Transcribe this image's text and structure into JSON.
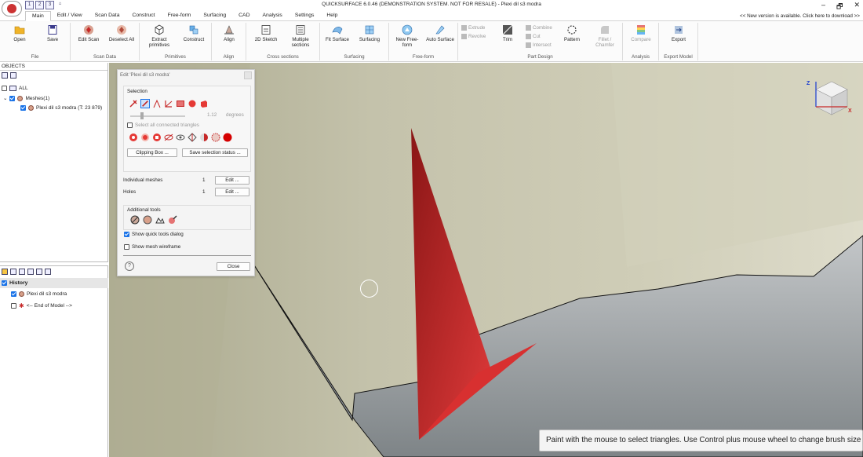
{
  "window": {
    "title": "QUICKSURFACE 6.0.46 (DEMONSTRATION SYSTEM. NOT FOR RESALE) - Plexi dil s3 modra",
    "update_notice": "<< New version is available. Click here to download >>",
    "qat": [
      "1",
      "2",
      "3"
    ],
    "controls": [
      "–",
      "🗗",
      "✕"
    ]
  },
  "tabs": [
    "Main",
    "Edit / View",
    "Scan Data",
    "Construct",
    "Free-form",
    "Surfacing",
    "CAD",
    "Analysis",
    "Settings",
    "Help"
  ],
  "ribbon": {
    "file": {
      "label": "File",
      "open": "Open",
      "save": "Save"
    },
    "scan_data": {
      "label": "Scan Data",
      "edit_scan": "Edit Scan",
      "deselect_all": "Deselect All"
    },
    "primitives": {
      "label": "Primitives",
      "extract": "Extract primitives",
      "construct": "Construct"
    },
    "align": {
      "label": "Align",
      "align": "Align"
    },
    "cross_sections": {
      "label": "Cross sections",
      "sketch2d": "2D Sketch",
      "multiple": "Multiple sections"
    },
    "surfacing": {
      "label": "Surfacing",
      "fit": "Fit Surface",
      "surfacing": "Surfacing"
    },
    "free_form": {
      "label": "Free-form",
      "new": "New Free-form",
      "auto": "Auto Surface"
    },
    "part_design": {
      "label": "Part Design",
      "extrude": "Extrude",
      "revolve": "Revolve",
      "trim": "Trim",
      "combine": "Combine",
      "cut": "Cut",
      "intersect": "Intersect",
      "pattern": "Pattern",
      "fillet": "Fillet / Chamfer"
    },
    "analysis": {
      "label": "Analysis",
      "compare": "Compare"
    },
    "export_model": {
      "label": "Export Model",
      "export": "Export"
    }
  },
  "objects_panel": {
    "header": "OBJECTS",
    "all": "ALL",
    "meshes": "Meshes(1)",
    "mesh_item": "Plexi dil s3 modra (T: 23 879)"
  },
  "history_panel": {
    "header": "History",
    "items": [
      "Plexi dil s3 modra",
      "<-- End of Model -->"
    ]
  },
  "dialog": {
    "title": "Edit 'Plexi dil s3 modra'",
    "selection_label": "Selection",
    "angle_value": "1.12",
    "angle_unit": "degrees",
    "select_connected": "Select all connected triangles",
    "clipping_box": "Clipping Box ...",
    "save_selection": "Save selection status ...",
    "individual_meshes_label": "Individual meshes",
    "individual_meshes_count": "1",
    "holes_label": "Holes",
    "holes_count": "1",
    "edit_button": "Edit ...",
    "additional_tools": "Additional tools",
    "show_quick_tools": "Show quick tools dialog",
    "show_wireframe": "Show mesh wireframe",
    "help": "?",
    "close": "Close"
  },
  "status_hint": "Paint with the mouse to select triangles. Use Control plus mouse wheel to change brush size",
  "navcube_axes": {
    "z": "Z",
    "x": "X"
  },
  "colors": {
    "selection_red": "#c62828",
    "mesh_beige": "#c9c7b2",
    "mesh_gray": "#9ea3a6",
    "accent_blue": "#1a73e8"
  }
}
